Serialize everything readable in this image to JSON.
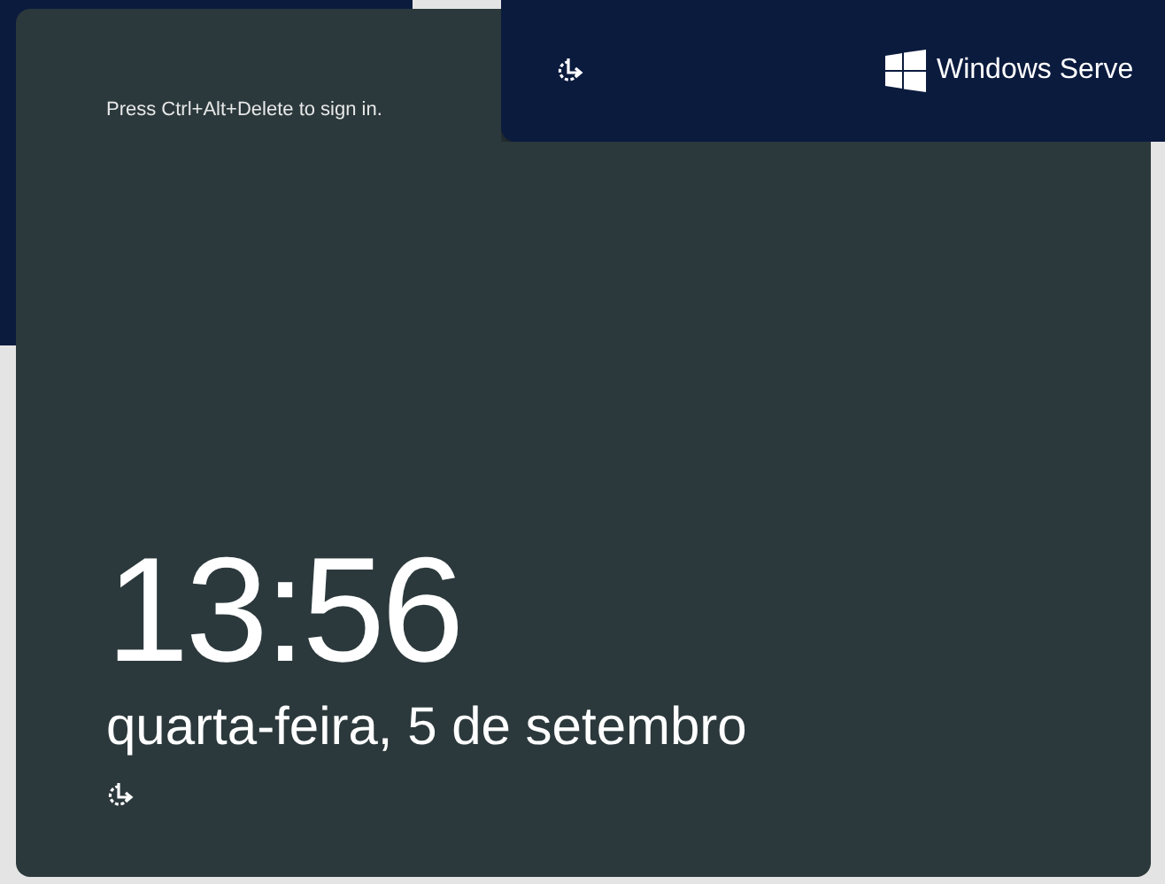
{
  "lock_screen": {
    "prompt": "Press Ctrl+Alt+Delete to sign in.",
    "time": "13:56",
    "date": "quarta-feira, 5 de setembro"
  },
  "top_bar": {
    "product_name": "Windows Serve"
  }
}
